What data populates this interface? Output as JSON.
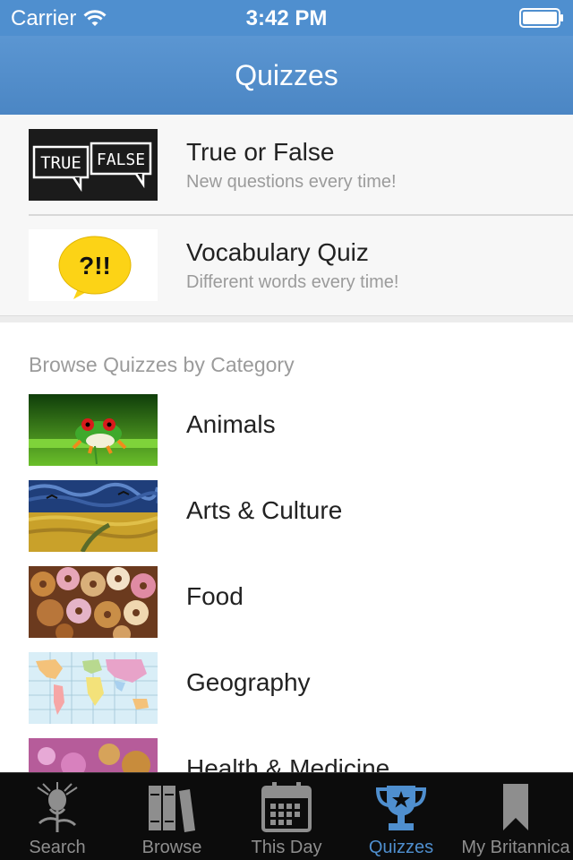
{
  "status_bar": {
    "carrier": "Carrier",
    "time": "3:42 PM",
    "wifi_icon": "wifi-icon",
    "battery_icon": "battery-icon"
  },
  "nav": {
    "title": "Quizzes"
  },
  "featured": [
    {
      "title": "True or False",
      "subtitle": "New questions every time!",
      "thumb_text_left": "TRUE",
      "thumb_text_right": "FALSE",
      "icon": "true-false-speech-bubbles"
    },
    {
      "title": "Vocabulary Quiz",
      "subtitle": "Different words every time!",
      "thumb_text": "?!!",
      "icon": "question-exclamation-bubble"
    }
  ],
  "categories_header": "Browse Quizzes by Category",
  "categories": [
    {
      "label": "Animals",
      "image": "red-eyed-tree-frog-photo"
    },
    {
      "label": "Arts & Culture",
      "image": "wheatfield-painting"
    },
    {
      "label": "Food",
      "image": "donuts-and-cookies-photo"
    },
    {
      "label": "Geography",
      "image": "world-map"
    },
    {
      "label": "Health & Medicine",
      "image": "microscope-cells-photo"
    }
  ],
  "tabs": [
    {
      "label": "Search",
      "icon": "thistle-icon",
      "active": false
    },
    {
      "label": "Browse",
      "icon": "books-icon",
      "active": false
    },
    {
      "label": "This Day",
      "icon": "calendar-icon",
      "active": false
    },
    {
      "label": "Quizzes",
      "icon": "trophy-icon",
      "active": true
    },
    {
      "label": "My Britannica",
      "icon": "bookmark-icon",
      "active": false
    }
  ],
  "colors": {
    "accent": "#4f8fcf",
    "tab_bar_bg": "#0c0c0c",
    "inactive_tab": "#8e8e8e"
  }
}
